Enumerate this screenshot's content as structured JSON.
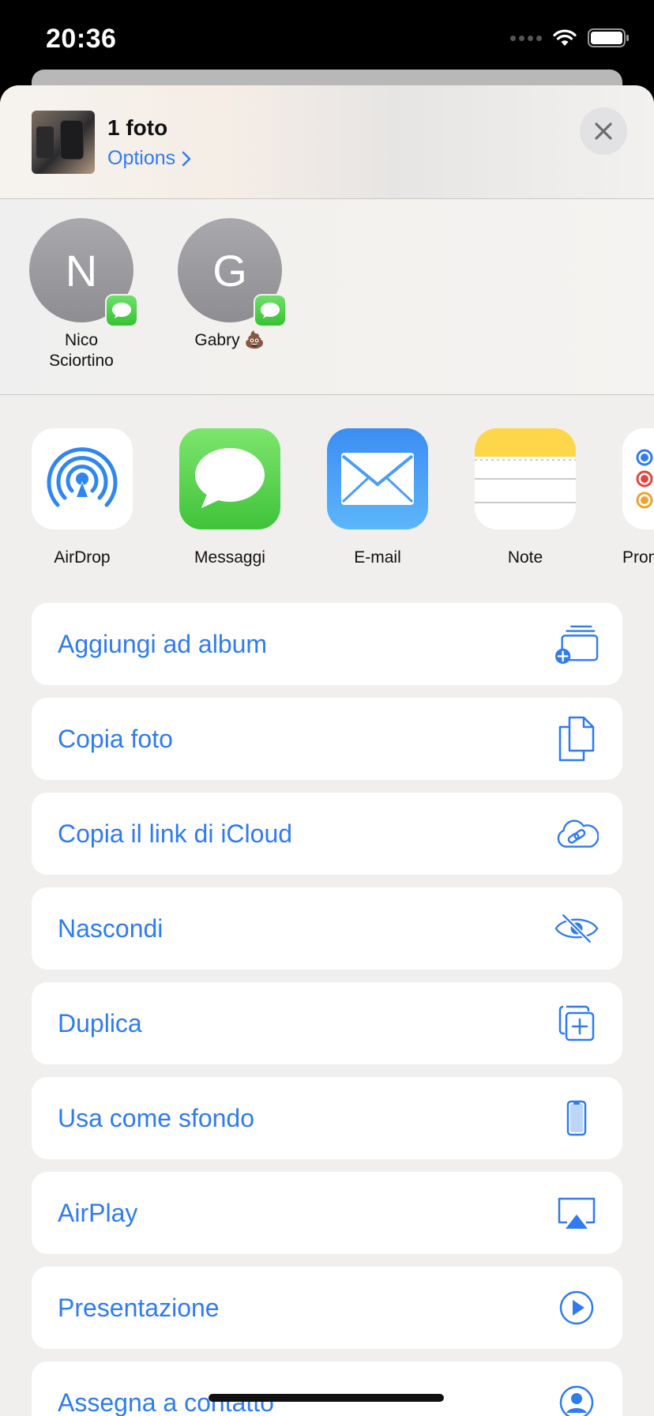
{
  "status_bar": {
    "time": "20:36"
  },
  "header": {
    "title": "1 foto",
    "options_label": "Options"
  },
  "contacts": [
    {
      "initial": "N",
      "name": "Nico Sciortino"
    },
    {
      "initial": "G",
      "name": "Gabry 💩"
    }
  ],
  "apps": [
    {
      "label": "AirDrop"
    },
    {
      "label": "Messaggi"
    },
    {
      "label": "E-mail"
    },
    {
      "label": "Note"
    },
    {
      "label": "Prom"
    }
  ],
  "actions": [
    {
      "label": "Aggiungi ad album",
      "icon": "add-to-album-icon"
    },
    {
      "label": "Copia foto",
      "icon": "copy-icon"
    },
    {
      "label": "Copia il link di iCloud",
      "icon": "icloud-link-icon"
    },
    {
      "label": "Nascondi",
      "icon": "eye-slash-icon"
    },
    {
      "label": "Duplica",
      "icon": "duplicate-icon"
    },
    {
      "label": "Usa come sfondo",
      "icon": "iphone-icon"
    },
    {
      "label": "AirPlay",
      "icon": "airplay-icon"
    },
    {
      "label": "Presentazione",
      "icon": "play-circle-icon"
    },
    {
      "label": "Assegna a contatto",
      "icon": "person-circle-icon"
    }
  ],
  "colors": {
    "accent": "#2f7bf0",
    "messages_green": "#4cd964",
    "mail_blue": "#3d8ef0",
    "notes_yellow": "#fdd64a"
  }
}
